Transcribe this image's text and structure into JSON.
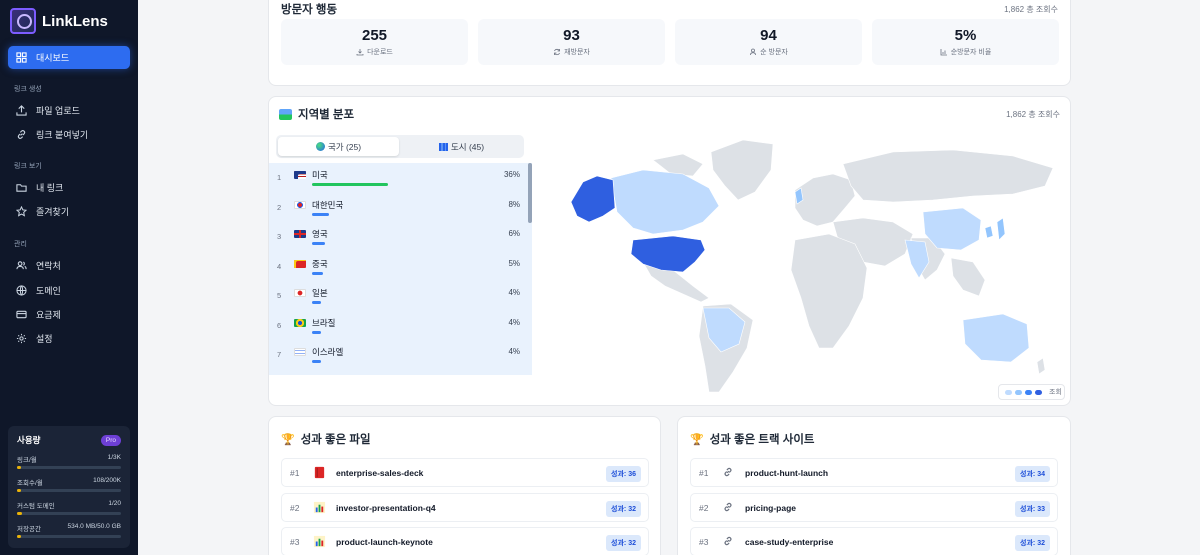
{
  "app": {
    "name": "LinkLens"
  },
  "sidebar": {
    "dashboard": "대시보드",
    "section_create": "링크 생성",
    "upload": "파일 업로드",
    "paste": "링크 붙여넣기",
    "section_view": "링크 보기",
    "my_links": "내 링크",
    "favorites": "즐겨찾기",
    "section_manage": "관리",
    "contacts": "연락처",
    "domains": "도메인",
    "billing": "요금제",
    "settings": "설정",
    "usage": {
      "title": "사용량",
      "badge": "Pro",
      "rows": [
        {
          "label": "링크/월",
          "value": "1/3K",
          "fraction": 0.0003
        },
        {
          "label": "조회수/월",
          "value": "108/200K",
          "fraction": 0.0005
        },
        {
          "label": "커스텀 도메인",
          "value": "1/20",
          "fraction": 0.05
        },
        {
          "label": "저장공간",
          "value": "534.0 MB/50.0 GB",
          "fraction": 0.01
        }
      ]
    }
  },
  "behavior": {
    "title": "방문자 행동",
    "total": "1,862 총 조회수",
    "stats": [
      {
        "value": "255",
        "label": "다운로드",
        "icon": "download-icon"
      },
      {
        "value": "93",
        "label": "재방문자",
        "icon": "refresh-icon"
      },
      {
        "value": "94",
        "label": "순 방문자",
        "icon": "user-icon"
      },
      {
        "value": "5%",
        "label": "순방문자 비율",
        "icon": "bar-chart-icon"
      }
    ]
  },
  "geo": {
    "title": "지역별 분포",
    "total": "1,862 총 조회수",
    "tab_country": "국가 (25)",
    "tab_city": "도시 (45)",
    "legend_label": "조회",
    "countries": [
      {
        "rank": "1",
        "name": "미국",
        "pct": "36%",
        "share": 0.36,
        "bar_color": "#22c55e"
      },
      {
        "rank": "2",
        "name": "대한민국",
        "pct": "8%",
        "share": 0.08,
        "bar_color": "#3b82f6"
      },
      {
        "rank": "3",
        "name": "영국",
        "pct": "6%",
        "share": 0.06,
        "bar_color": "#3b82f6"
      },
      {
        "rank": "4",
        "name": "중국",
        "pct": "5%",
        "share": 0.05,
        "bar_color": "#3b82f6"
      },
      {
        "rank": "5",
        "name": "일본",
        "pct": "4%",
        "share": 0.04,
        "bar_color": "#3b82f6"
      },
      {
        "rank": "6",
        "name": "브라질",
        "pct": "4%",
        "share": 0.04,
        "bar_color": "#3b82f6"
      },
      {
        "rank": "7",
        "name": "이스라엘",
        "pct": "4%",
        "share": 0.04,
        "bar_color": "#3b82f6"
      }
    ]
  },
  "top_files": {
    "title": "성과 좋은 파일",
    "items": [
      {
        "rank": "#1",
        "name": "enterprise-sales-deck",
        "score": "성과: 36",
        "icon": "book-icon"
      },
      {
        "rank": "#2",
        "name": "investor-presentation-q4",
        "score": "성과: 32",
        "icon": "chart-icon"
      },
      {
        "rank": "#3",
        "name": "product-launch-keynote",
        "score": "성과: 32",
        "icon": "chart-icon"
      }
    ]
  },
  "top_sites": {
    "title": "성과 좋은 트랙 사이트",
    "items": [
      {
        "rank": "#1",
        "name": "product-hunt-launch",
        "score": "성과: 34",
        "icon": "link-icon"
      },
      {
        "rank": "#2",
        "name": "pricing-page",
        "score": "성과: 33",
        "icon": "link-icon"
      },
      {
        "rank": "#3",
        "name": "case-study-enterprise",
        "score": "성과: 32",
        "icon": "link-icon"
      }
    ]
  }
}
